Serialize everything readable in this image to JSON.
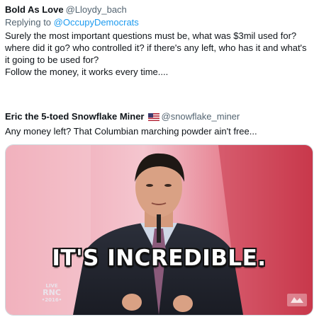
{
  "replies": [
    {
      "name": "Bold As Love",
      "handle": "@Lloydy_bach",
      "replying_prefix": "Replying to",
      "replying_to": "@OccupyDemocrats",
      "text_lines": [
        "Surely the most important questions must be, what was $3mil used for?",
        "where did it go? who controlled it? if there's any left, who has it and what's",
        "it going to be used for?",
        "Follow the money, it works every time...."
      ]
    },
    {
      "name": "Eric the 5-toed Snowflake Miner",
      "name_emoji": "us-flag-icon",
      "handle": "@snowflake_miner",
      "text_lines": [
        "Any money left? That Columbian marching powder ain't free..."
      ],
      "media": {
        "type": "gif",
        "caption": "IT'S INCREDIBLE.",
        "badge_lines": [
          "LIVE",
          "RNC",
          "•2016•"
        ]
      }
    }
  ],
  "colors": {
    "text": "#0f1419",
    "secondary": "#536471",
    "link": "#1d9bf0",
    "stage_pink": "#e88a9c"
  }
}
